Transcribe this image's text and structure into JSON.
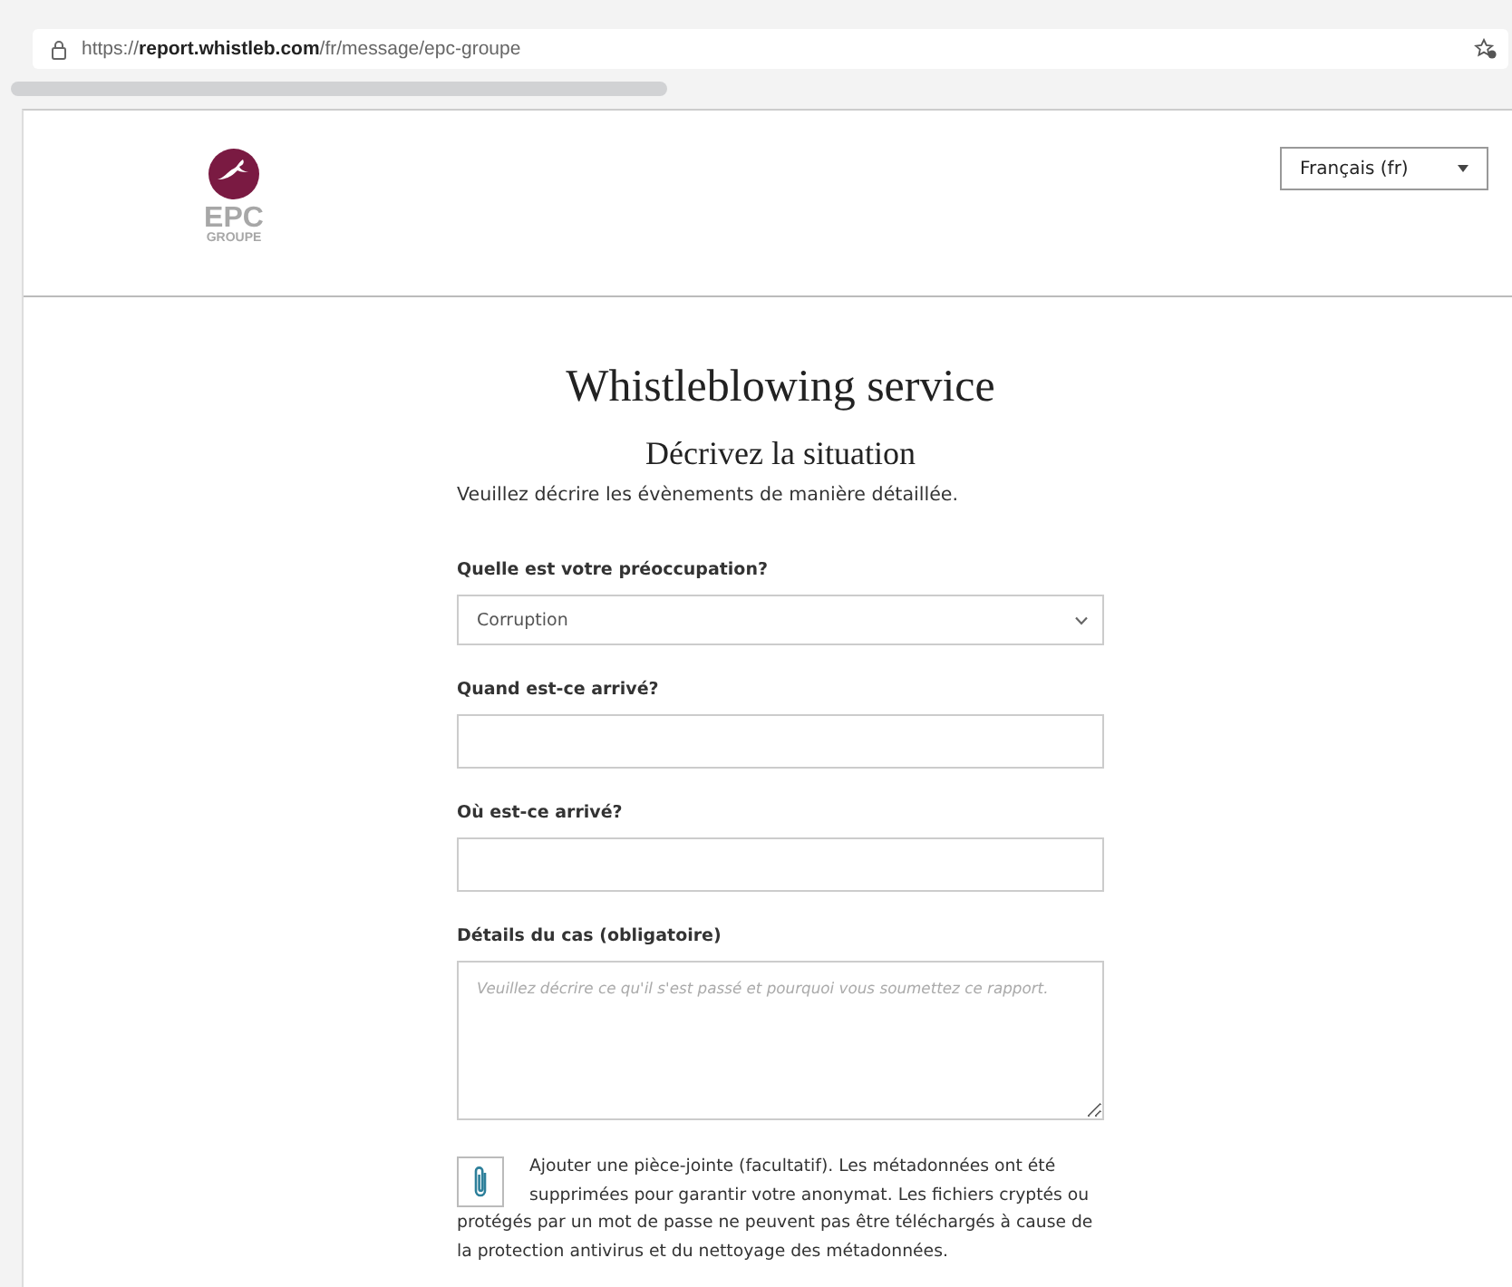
{
  "browser": {
    "url": "https://**report.whistleb.com**/fr/message/epc-groupe"
  },
  "header": {
    "logo_text": "EPC",
    "logo_subtext": "GROUPE",
    "language": "Français (fr)"
  },
  "title": "Whistleblowing service",
  "subtitle": "Décrivez la situation",
  "intro": "Veuillez décrire les évènements de manière détaillée.",
  "fields": [
    {
      "kind": "select",
      "label": "Quelle est votre préoccupation?",
      "value": "Corruption"
    },
    {
      "kind": "text",
      "label": "Quand est-ce arrivé?"
    },
    {
      "kind": "text",
      "label": "Où est-ce arrivé?"
    },
    {
      "kind": "textarea",
      "label": "Détails du cas (obligatoire)",
      "placeholder": "Veuillez décrire ce qu'il s'est passé et pourquoi vous soumettez ce rapport."
    }
  ],
  "attachment": {
    "text": "Ajouter une pièce-jointe (facultatif). Les métadonnées ont été supprimées pour garantir votre anonymat. Les fichiers cryptés ou protégés par un mot de passe ne peuvent pas être téléchargés à cause de la protection antivirus et du nettoyage des métadonnées."
  }
}
